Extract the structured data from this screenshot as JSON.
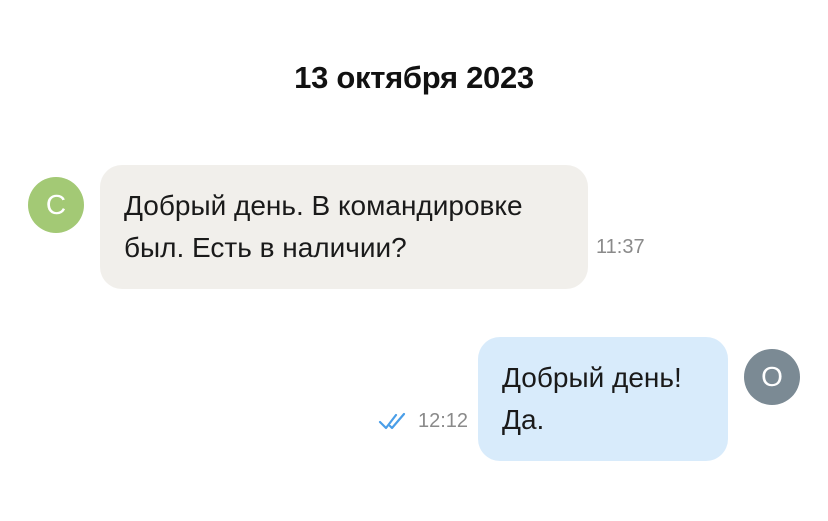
{
  "date_header": "13 октября 2023",
  "messages": [
    {
      "direction": "incoming",
      "avatar_letter": "C",
      "avatar_color": "#a3c975",
      "lines": [
        "Добрый день. В командировке",
        "был. Есть в наличии?"
      ],
      "time": "11:37"
    },
    {
      "direction": "outgoing",
      "avatar_letter": "O",
      "avatar_color": "#7b8a94",
      "lines": [
        "Добрый день!",
        "Да."
      ],
      "time": "12:12",
      "status_icon": "double-check-icon",
      "status_color": "#4a9ee8"
    }
  ],
  "colors": {
    "incoming_bubble": "#f1efeb",
    "outgoing_bubble": "#d8ebfb"
  }
}
